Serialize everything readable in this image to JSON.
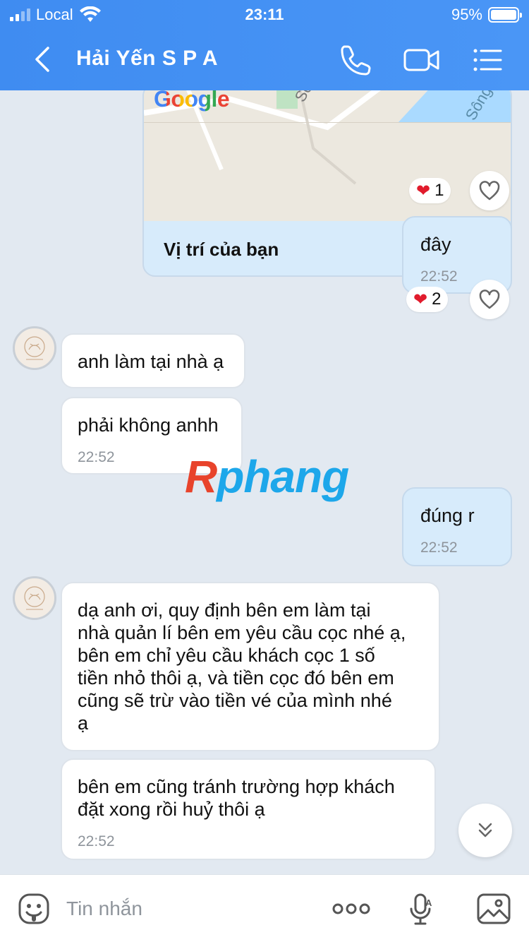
{
  "status_bar": {
    "carrier": "Local",
    "time": "23:11",
    "battery": "95%"
  },
  "header": {
    "title": "Hải Yến S P A"
  },
  "map_card": {
    "brand": "Google",
    "label": "Vị trí của bạn",
    "reaction_count": "1"
  },
  "messages": [
    {
      "side": "me",
      "text": "đây",
      "time": "22:52",
      "reaction_count": "2"
    },
    {
      "side": "them",
      "text": "anh làm tại nhà ạ"
    },
    {
      "side": "them",
      "text": "phải không anhh",
      "time": "22:52"
    },
    {
      "side": "me",
      "text": "đúng r",
      "time": "22:52"
    },
    {
      "side": "them",
      "lines": [
        "dạ anh ơi, quy định bên em làm tại",
        "nhà quản lí bên em yêu cầu cọc nhé ạ,",
        "bên em chỉ yêu cầu khách cọc 1 số",
        "tiền nhỏ thôi ạ, và tiền cọc đó bên em",
        "cũng sẽ trừ vào tiền vé của mình nhé",
        "ạ"
      ]
    },
    {
      "side": "them",
      "lines": [
        "bên em cũng tránh trường hợp khách",
        "đặt xong rồi huỷ thôi ạ"
      ],
      "time": "22:52"
    }
  ],
  "watermark": {
    "first": "R",
    "rest": "phang"
  },
  "input": {
    "placeholder": "Tin nhắn"
  },
  "colors": {
    "header": "#4490f4",
    "heart": "#e11b2c",
    "my_bubble": "#d7ebfb"
  }
}
